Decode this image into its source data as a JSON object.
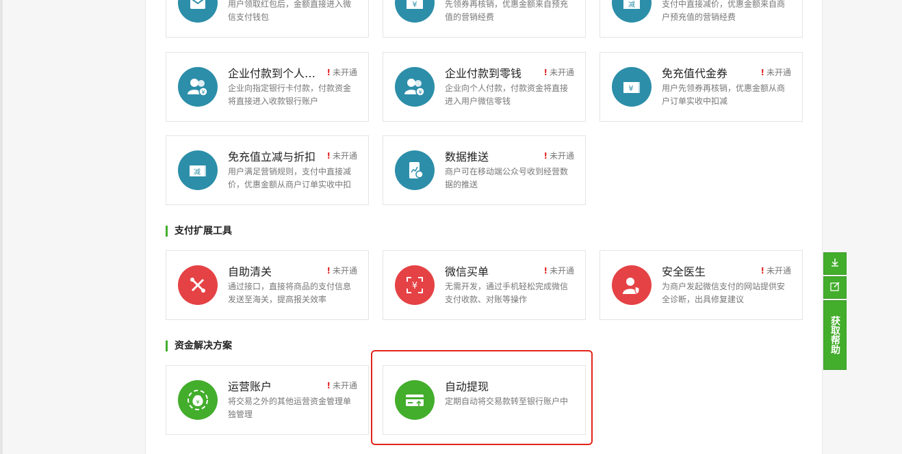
{
  "status_label": "未开通",
  "top_row": [
    {
      "desc": "用户领取红包后，金额直接进入微信支付钱包"
    },
    {
      "desc": "先领券再核销，优惠金额来自预充值的营销经费"
    },
    {
      "desc": "支付中直接减价，优惠金额来自商户预充值的营销经费"
    }
  ],
  "marketing_cards": [
    {
      "title": "企业付款到个人银行卡",
      "status": "未开通",
      "desc": "企业向指定银行卡付款，付款资金将直接进入收款银行账户",
      "icon": "users-yuan-icon"
    },
    {
      "title": "企业付款到零钱",
      "status": "未开通",
      "desc": "企业向个人付款，付款资金将直接进入用户微信零钱",
      "icon": "users-yuan-icon"
    },
    {
      "title": "免充值代金券",
      "status": "未开通",
      "desc": "用户先领券再核销，优惠金额从商户订单实收中扣减",
      "icon": "coupon-yuan-icon"
    },
    {
      "title": "免充值立减与折扣",
      "status": "未开通",
      "desc": "用户满足营销规则，支付中直接减价，优惠金额从商户订单实收中扣",
      "icon": "coupon-discount-icon"
    },
    {
      "title": "数据推送",
      "status": "未开通",
      "desc": "商户可在移动端公众号收到经营数据的推送",
      "icon": "phone-chart-icon"
    }
  ],
  "sections": {
    "payment_tools": "支付扩展工具",
    "funds": "资金解决方案"
  },
  "tool_cards": [
    {
      "title": "自助清关",
      "status": "未开通",
      "desc": "通过接口，直接将商品的支付信息发送至海关，提高报关效率",
      "icon": "tools-icon"
    },
    {
      "title": "微信买单",
      "status": "未开通",
      "desc": "无需开发，通过手机轻松完成微信支付收款、对账等操作",
      "icon": "scan-yuan-icon"
    },
    {
      "title": "安全医生",
      "status": "未开通",
      "desc": "为商户发起微信支付的网站提供安全诊断，出具修复建议",
      "icon": "doctor-shield-icon"
    }
  ],
  "fund_cards": [
    {
      "title": "运营账户",
      "status": "未开通",
      "desc": "将交易之外的其他运营资金管理单独管理",
      "icon": "money-bag-icon"
    },
    {
      "title": "自动提现",
      "status": "",
      "desc": "定期自动将交易款转至银行账户中",
      "icon": "card-upload-icon"
    }
  ],
  "sidebar": {
    "help_label": "获取帮助"
  },
  "colors": {
    "teal": "#2c8ea9",
    "red": "#e54245",
    "green": "#43ad2c",
    "highlight": "#e2231a"
  }
}
